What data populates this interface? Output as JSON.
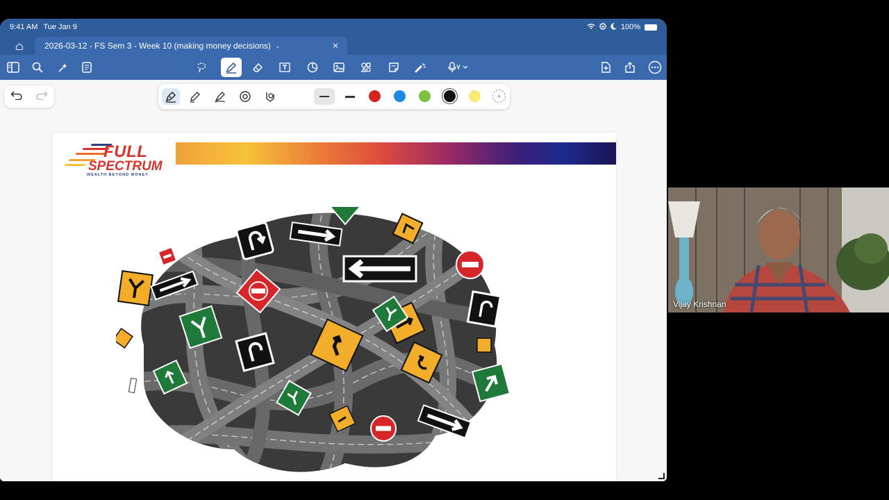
{
  "status_bar": {
    "time": "9:41 AM",
    "date": "Tue Jan 9",
    "battery": "100%"
  },
  "tab": {
    "title": "2026-03-12 - FS Sem 3 - Week 10 (making money decisions)"
  },
  "toolbar": {
    "left_icons": [
      "sidebar-icon",
      "search-icon",
      "sparkle-icon",
      "document-icon"
    ],
    "center_icons": [
      "lasso-icon",
      "pen-icon",
      "eraser-icon",
      "textbox-icon",
      "shape-icon",
      "image-icon",
      "elements-icon",
      "sticky-note-icon",
      "laser-pointer-icon",
      "microphone-icon"
    ],
    "right_icons": [
      "add-page-icon",
      "share-icon",
      "more-icon"
    ],
    "active_tool": "pen-icon"
  },
  "pen_palette": {
    "tools": [
      "fountain-pen-icon",
      "ball-pen-icon",
      "brush-pen-icon",
      "shape-tool-icon",
      "stabilizer-icon"
    ],
    "colors": [
      "#d4221c",
      "#1e88e5",
      "#7cc142",
      "#111111",
      "#fce874"
    ],
    "selected_color": "#111111"
  },
  "slide": {
    "logo": {
      "line1": "FULL",
      "line2": "SPECTRUM",
      "tagline": "WEALTH BEYOND MONEY"
    }
  },
  "participant": {
    "name": "Vijay Krishnan"
  }
}
